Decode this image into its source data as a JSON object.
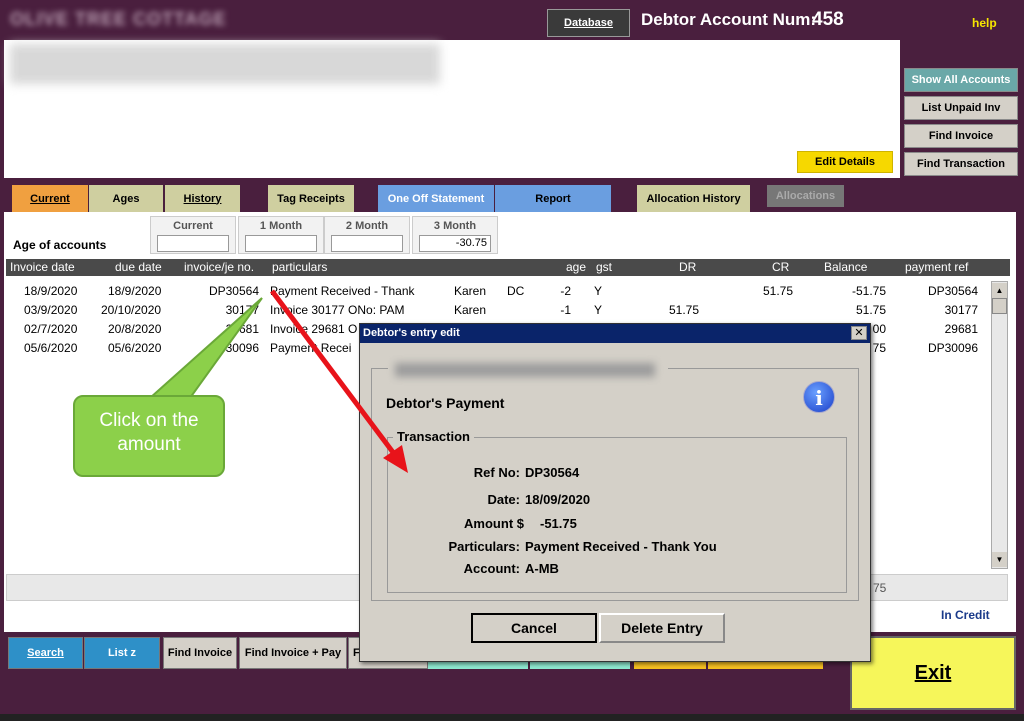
{
  "app": {
    "brand": "OLIVE TREE COTTAGE",
    "database_label": "Database",
    "account_label": "Debtor Account Num:",
    "account_num": "458",
    "help": "help"
  },
  "header": {
    "edit_details": "Edit Details"
  },
  "right_panel": {
    "show_all": "Show All Accounts",
    "list_unpaid": "List Unpaid Inv",
    "find_invoice": "Find Invoice",
    "find_transaction": "Find Transaction"
  },
  "tabs": {
    "current": "Current",
    "ages": "Ages",
    "history": "History",
    "tag_receipts": "Tag Receipts",
    "one_off": "One Off Statement",
    "report": "Report",
    "allocation_history": "Allocation History",
    "allocations": "Allocations"
  },
  "ages": {
    "label": "Age of accounts",
    "boxes": [
      {
        "label": "Current",
        "value": ""
      },
      {
        "label": "1 Month",
        "value": ""
      },
      {
        "label": "2 Month",
        "value": ""
      },
      {
        "label": "3 Month",
        "value": "-30.75"
      }
    ]
  },
  "table": {
    "headers": {
      "invoice_date": "Invoice date",
      "due_date": "due date",
      "invoice_no": "invoice/je no.",
      "particulars": "particulars",
      "age": "age",
      "gst": "gst",
      "dr": "DR",
      "cr": "CR",
      "balance": "Balance",
      "payment_ref": "payment ref"
    },
    "rows": [
      {
        "invoice_date": "18/9/2020",
        "due_date": "18/9/2020",
        "invoice_no": "DP30564",
        "particulars": "Payment Received - Thank",
        "user": "Karen",
        "code": "DC",
        "age": "-2",
        "gst": "Y",
        "dr": "",
        "cr": "51.75",
        "balance": "-51.75",
        "payment_ref": "DP30564"
      },
      {
        "invoice_date": "03/9/2020",
        "due_date": "20/10/2020",
        "invoice_no": "30177",
        "particulars": "Invoice 30177 ONo: PAM",
        "user": "Karen",
        "code": "",
        "age": "-1",
        "gst": "Y",
        "dr": "51.75",
        "cr": "",
        "balance": "51.75",
        "payment_ref": "30177"
      },
      {
        "invoice_date": "02/7/2020",
        "due_date": "20/8/2020",
        "invoice_no": "29681",
        "particulars": "Invoice 29681 O",
        "user": "",
        "code": "",
        "age": "",
        "gst": "",
        "dr": "",
        "cr": "",
        "balance": "00",
        "payment_ref": "29681"
      },
      {
        "invoice_date": "05/6/2020",
        "due_date": "05/6/2020",
        "invoice_no": "DP30096",
        "particulars": "Payment Recei",
        "user": "",
        "code": "",
        "age": "",
        "gst": "",
        "dr": "",
        "cr": "",
        "balance": "75",
        "payment_ref": "DP30096"
      }
    ]
  },
  "footer": {
    "hbar_value": "75",
    "in_credit": "In Credit"
  },
  "bottom": {
    "search": "Search",
    "list_z": "List z",
    "find_invoice": "Find Invoice",
    "find_invoice_pay": "Find Invoice + Pay",
    "f": "F",
    "exit": "Exit"
  },
  "dialog": {
    "title": "Debtor's entry edit",
    "close": "✕",
    "heading": "Debtor's Payment",
    "transaction_legend": "Transaction",
    "fields": [
      {
        "label": "Ref No:",
        "value": "DP30564"
      },
      {
        "label": "Date:",
        "value": "18/09/2020"
      },
      {
        "label": "Amount $",
        "value": "-51.75"
      },
      {
        "label": "Particulars:",
        "value": "Payment Received - Thank You"
      },
      {
        "label": "Account:",
        "value": "A-MB"
      }
    ],
    "cancel": "Cancel",
    "delete": "Delete Entry"
  },
  "callout": {
    "text": "Click on the amount"
  },
  "colors": {
    "frame": "#4a1f3e",
    "accent_orange": "#f0a040",
    "accent_blue": "#6a9ee0",
    "exit_yellow": "#f6f65a",
    "callout_green": "#8cd04a",
    "arrow_red": "#e8131a"
  },
  "icons": {
    "info": "info-icon",
    "close": "close-icon",
    "scroll_up": "arrow-up-icon",
    "scroll_down": "arrow-down-icon"
  }
}
